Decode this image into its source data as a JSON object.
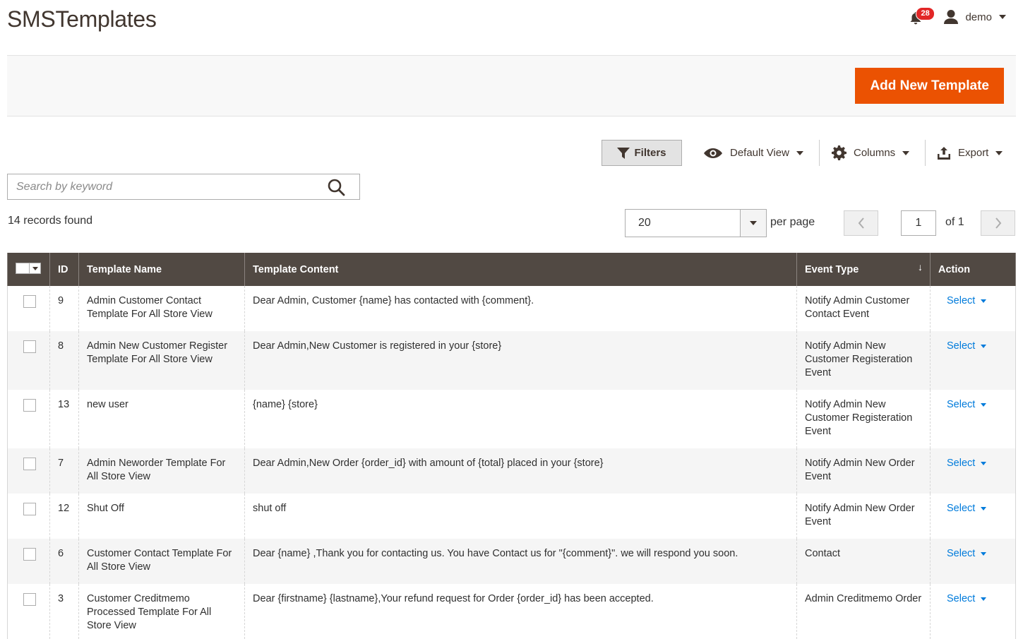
{
  "page": {
    "title": "SMSTemplates"
  },
  "header": {
    "notification_count": "28",
    "user_name": "demo"
  },
  "actions": {
    "add_new_label": "Add New Template"
  },
  "toolbar": {
    "filters_label": "Filters",
    "view_label": "Default View",
    "columns_label": "Columns",
    "export_label": "Export"
  },
  "search": {
    "placeholder": "Search by keyword",
    "value": ""
  },
  "grid": {
    "records_found": "14 records found",
    "per_page_value": "20",
    "per_page_label": "per page",
    "current_page": "1",
    "of_pages": "of 1",
    "columns": {
      "id": "ID",
      "name": "Template Name",
      "content": "Template Content",
      "event": "Event Type",
      "action": "Action"
    },
    "sort_indicator": "↓",
    "rows": [
      {
        "id": "9",
        "name": "Admin Customer Contact Template For All Store View",
        "content": "Dear Admin, Customer {name} has contacted with {comment}.",
        "event": "Notify Admin Customer Contact Event",
        "action": "Select"
      },
      {
        "id": "8",
        "name": "Admin New Customer Register Template For All Store View",
        "content": "Dear Admin,New Customer is registered in your {store}",
        "event": "Notify Admin New Customer Registeration Event",
        "action": "Select"
      },
      {
        "id": "13",
        "name": "new user",
        "content": "{name} {store}",
        "event": "Notify Admin New Customer Registeration Event",
        "action": "Select"
      },
      {
        "id": "7",
        "name": "Admin Neworder Template For All Store View",
        "content": "Dear Admin,New Order {order_id} with amount of {total} placed in your {store}",
        "event": "Notify Admin New Order Event",
        "action": "Select"
      },
      {
        "id": "12",
        "name": "Shut Off",
        "content": "shut off",
        "event": "Notify Admin New Order Event",
        "action": "Select"
      },
      {
        "id": "6",
        "name": "Customer Contact Template For All Store View",
        "content": "Dear {name} ,Thank you for contacting us. You have Contact us for \"{comment}\". we will respond you soon.",
        "event": "Contact",
        "action": "Select"
      },
      {
        "id": "3",
        "name": "Customer Creditmemo Processed Template For All Store View",
        "content": "Dear {firstname} {lastname},Your refund request for Order {order_id} has been accepted.",
        "event": "Admin Creditmemo Order",
        "action": "Select"
      }
    ]
  },
  "colors": {
    "accent": "#eb5202",
    "header_bg": "#514943",
    "link": "#007bdb",
    "badge": "#e22626"
  }
}
